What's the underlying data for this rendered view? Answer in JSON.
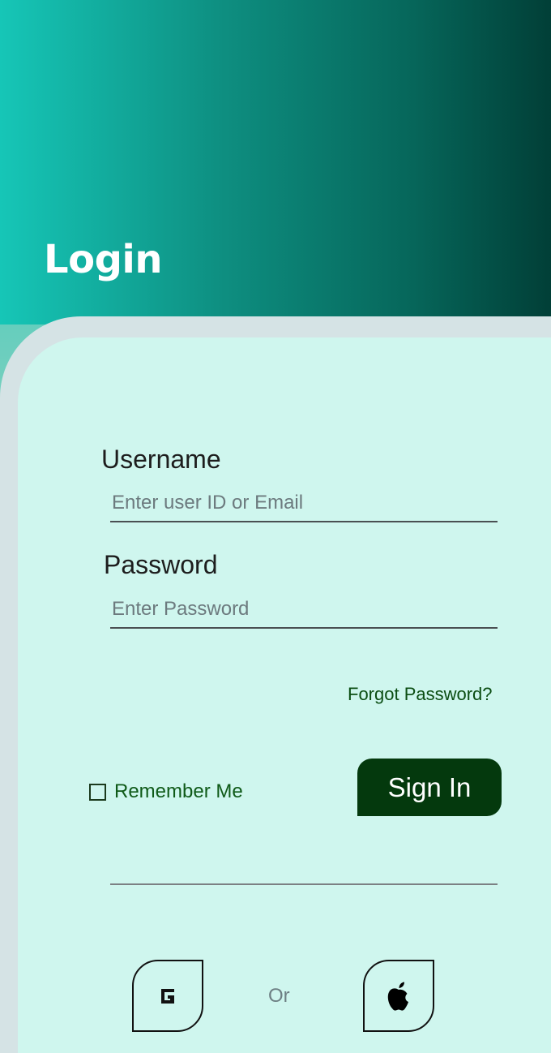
{
  "header": {
    "title": "Login"
  },
  "form": {
    "username_label": "Username",
    "username_placeholder": "Enter user ID or Email",
    "password_label": "Password",
    "password_placeholder": "Enter Password",
    "forgot_label": "Forgot Password?",
    "remember_label": "Remember Me",
    "signin_label": "Sign In"
  },
  "social": {
    "or_label": "Or",
    "google_icon": "google-icon",
    "apple_icon": "apple-icon"
  },
  "colors": {
    "header_start": "#16c6b7",
    "header_end": "#013f37",
    "card_bg": "#cff6ee",
    "signin_bg": "#04390d",
    "link": "#0b4d12"
  }
}
